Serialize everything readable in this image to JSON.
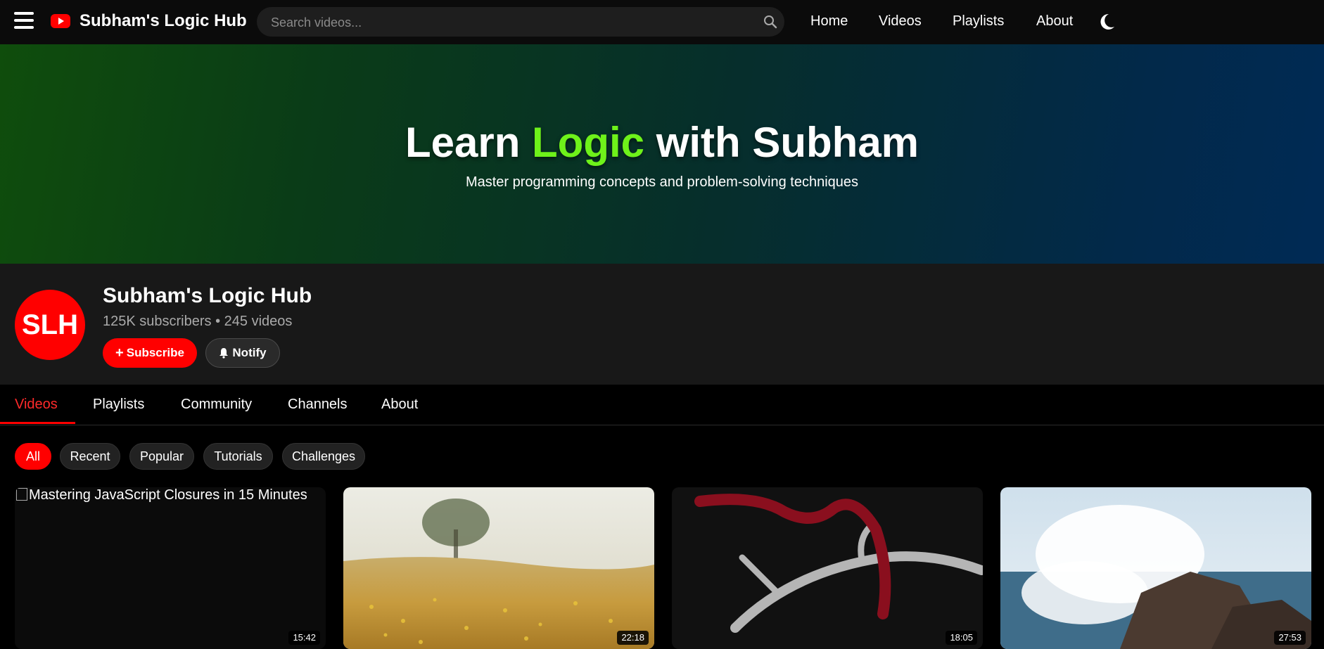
{
  "header": {
    "brand": "Subham's Logic Hub",
    "search_placeholder": "Search videos...",
    "nav": [
      "Home",
      "Videos",
      "Playlists",
      "About"
    ]
  },
  "hero": {
    "title_before": "Learn ",
    "title_accent": "Logic",
    "title_after": " with Subham",
    "subtitle": "Master programming concepts and problem-solving techniques"
  },
  "channel": {
    "avatar_initials": "SLH",
    "name": "Subham's Logic Hub",
    "stats": "125K subscribers • 245 videos",
    "subscribe_label": "Subscribe",
    "notify_label": "Notify"
  },
  "tabs": [
    "Videos",
    "Playlists",
    "Community",
    "Channels",
    "About"
  ],
  "filters": [
    "All",
    "Recent",
    "Popular",
    "Tutorials",
    "Challenges"
  ],
  "videos": [
    {
      "title": "Mastering JavaScript Closures in 15 Minutes",
      "duration": "15:42"
    },
    {
      "title": "",
      "duration": "22:18"
    },
    {
      "title": "",
      "duration": "18:05"
    },
    {
      "title": "",
      "duration": "27:53"
    }
  ],
  "colors": {
    "accent_red": "#ff0000",
    "hero_accent_green": "#6ef21a"
  }
}
